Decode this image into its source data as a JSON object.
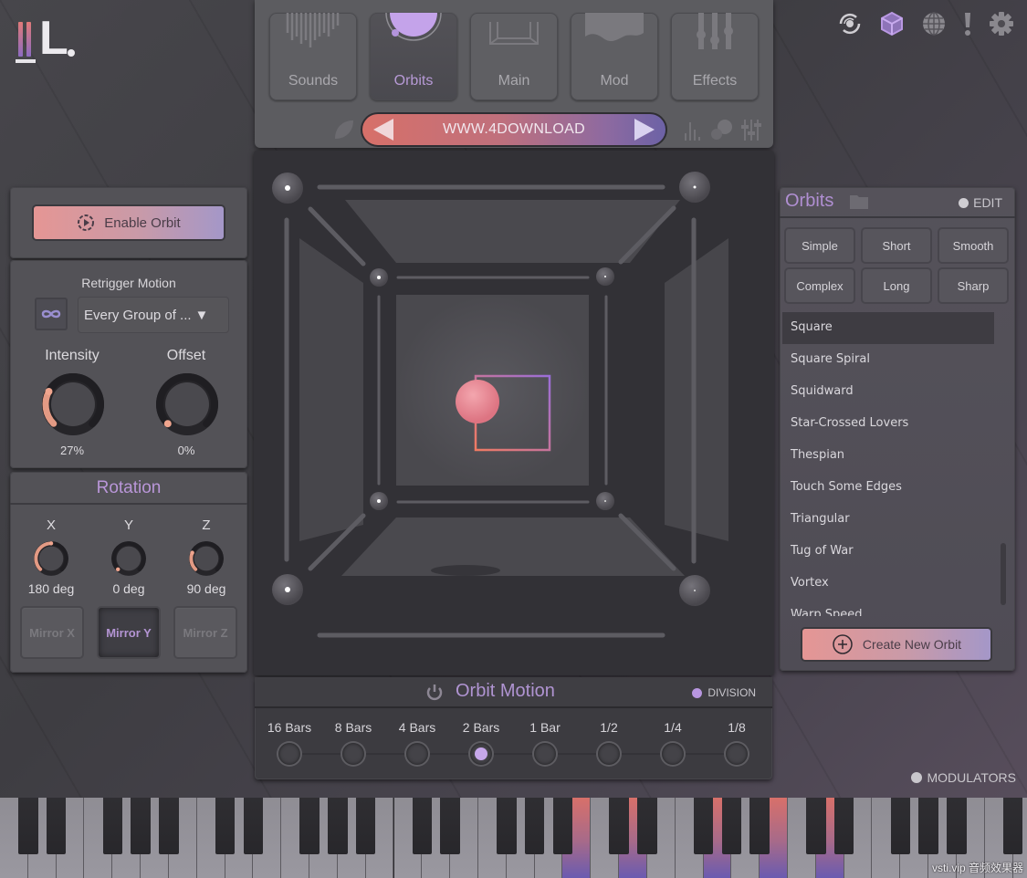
{
  "brand": {
    "logo_letter": "L"
  },
  "top_icons": [
    {
      "name": "galaxy-icon",
      "active": false
    },
    {
      "name": "cube-icon",
      "active": true
    },
    {
      "name": "globe-icon",
      "active": false
    },
    {
      "name": "alert-icon",
      "active": false
    },
    {
      "name": "gear-icon",
      "active": false
    }
  ],
  "tabs": [
    {
      "label": "Sounds",
      "active": false
    },
    {
      "label": "Orbits",
      "active": true
    },
    {
      "label": "Main",
      "active": false
    },
    {
      "label": "Mod",
      "active": false
    },
    {
      "label": "Effects",
      "active": false
    }
  ],
  "preset": {
    "name": "WWW.4DOWNLOAD"
  },
  "enable_orbit": {
    "label": "Enable Orbit"
  },
  "retrigger": {
    "title": "Retrigger Motion",
    "selected": "Every Group of ..."
  },
  "knobs": {
    "intensity": {
      "label": "Intensity",
      "value": "27%",
      "fraction": 0.27
    },
    "offset": {
      "label": "Offset",
      "value": "0%",
      "fraction": 0.0
    }
  },
  "rotation": {
    "title": "Rotation",
    "axes": [
      {
        "label": "X",
        "value": "180 deg",
        "fraction": 0.5
      },
      {
        "label": "Y",
        "value": "0 deg",
        "fraction": 0.0
      },
      {
        "label": "Z",
        "value": "90 deg",
        "fraction": 0.25
      }
    ],
    "mirrors": [
      {
        "label": "Mirror X",
        "active": false
      },
      {
        "label": "Mirror Y",
        "active": true
      },
      {
        "label": "Mirror Z",
        "active": false
      }
    ]
  },
  "orbits": {
    "title": "Orbits",
    "edit_label": "EDIT",
    "categories": [
      "Simple",
      "Short",
      "Smooth",
      "Complex",
      "Long",
      "Sharp"
    ],
    "list": [
      "Square",
      "Square Spiral",
      "Squidward",
      "Star-Crossed Lovers",
      "Thespian",
      "Touch Some Edges",
      "Triangular",
      "Tug of War",
      "Vortex",
      "Warp Speed"
    ],
    "selected": "Square",
    "create_label": "Create New Orbit"
  },
  "orbit_motion": {
    "title": "Orbit Motion",
    "division_label": "DIVISION",
    "divisions": [
      "16 Bars",
      "8 Bars",
      "4 Bars",
      "2 Bars",
      "1 Bar",
      "1/2",
      "1/4",
      "1/8"
    ],
    "selected": "2 Bars"
  },
  "modulators": {
    "label": "MODULATORS"
  },
  "keyboard": {
    "lit_white_keys": [
      20,
      22,
      25,
      27,
      29
    ],
    "lit_black_keys": []
  },
  "watermark": "vsti.vip 音频效果器",
  "colors": {
    "accent_purple": "#b996d8",
    "accent_coral": "#e07a6c"
  }
}
